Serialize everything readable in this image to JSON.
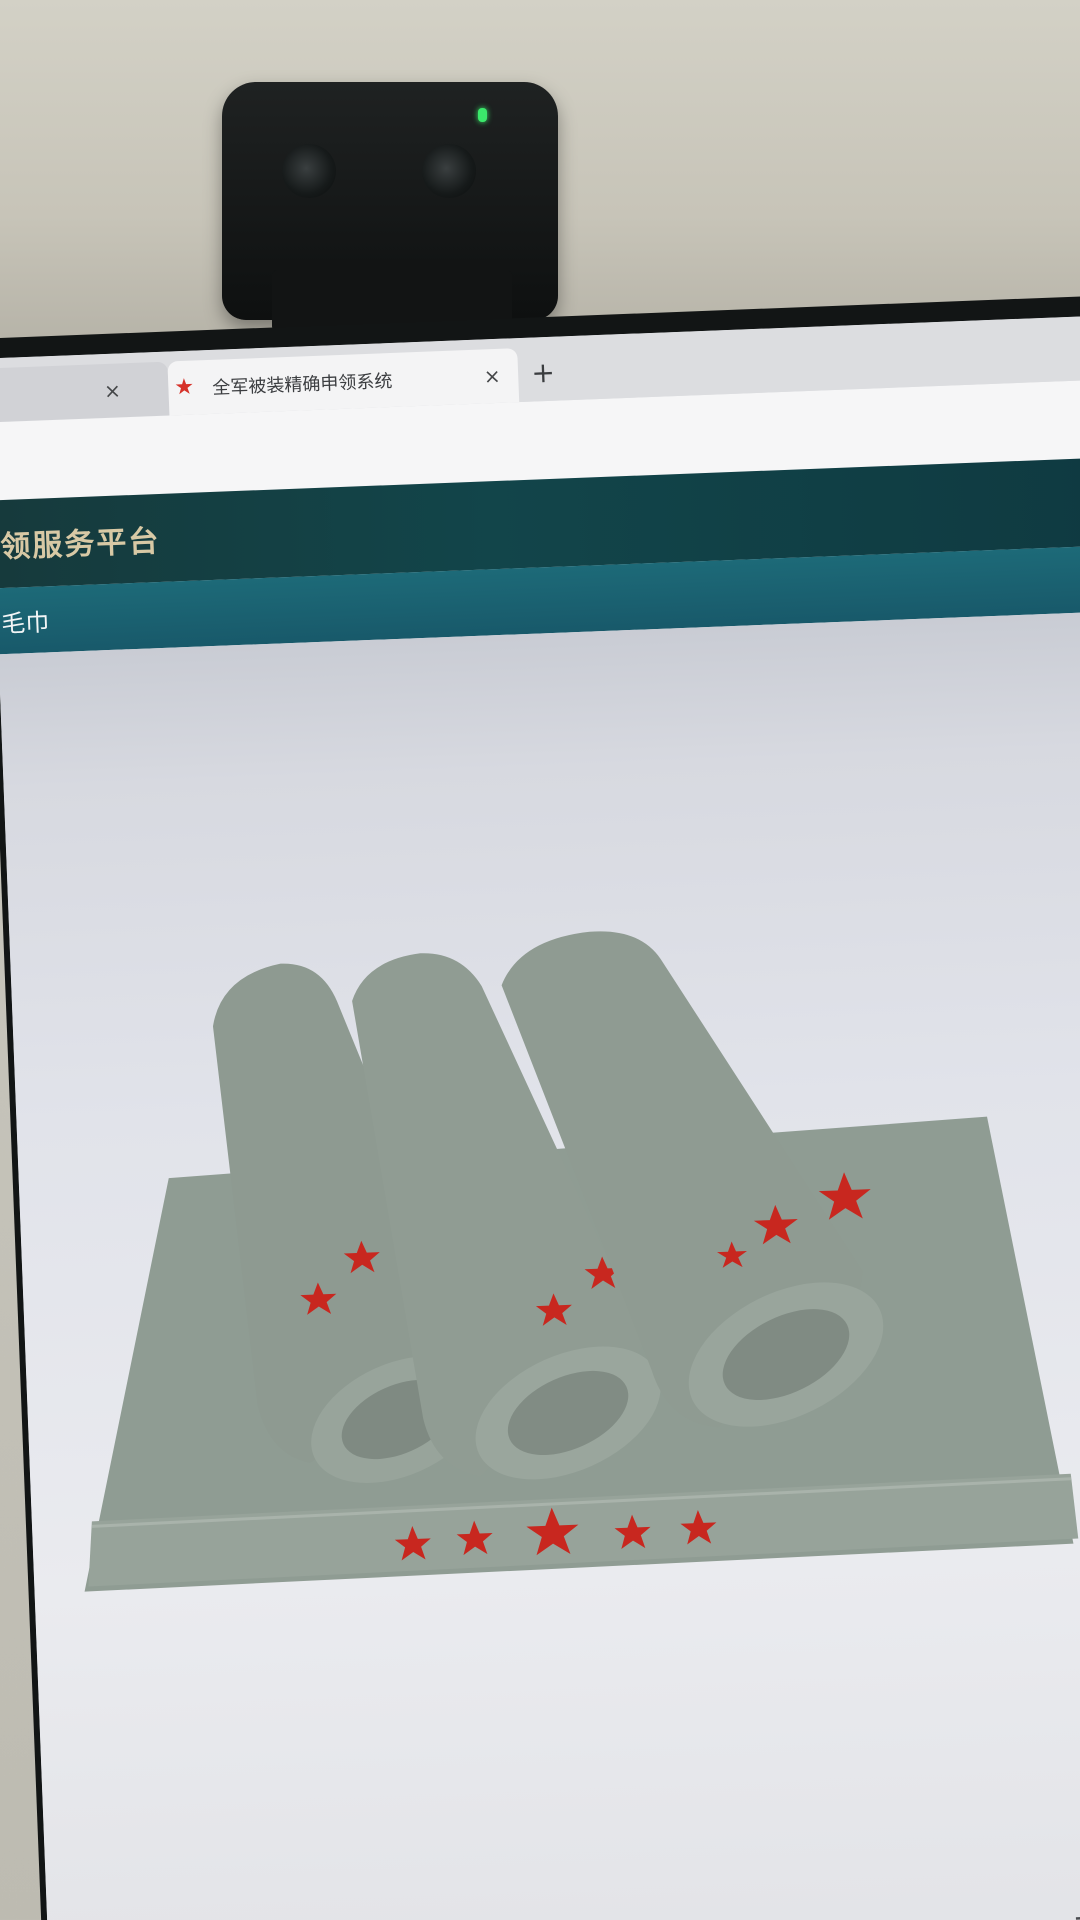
{
  "browser": {
    "tabs": [
      {
        "label": "",
        "close_icon": "×",
        "active": false
      },
      {
        "label": "全军被装精确申领系统",
        "close_icon": "×",
        "active": true,
        "favicon": "star-icon"
      }
    ],
    "new_tab_icon": "+"
  },
  "site": {
    "title": "领服务平台",
    "breadcrumb": "毛巾"
  },
  "product": {
    "image": "towel-set-image",
    "accent_color": "#d6322a",
    "towel_color": "#8f9c93"
  },
  "corner_icon": "+"
}
